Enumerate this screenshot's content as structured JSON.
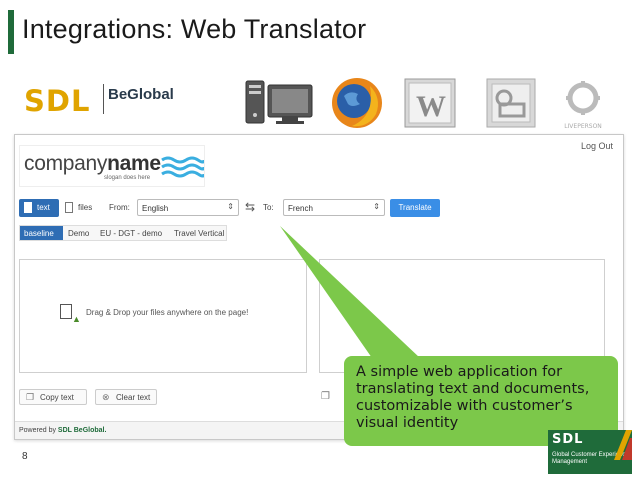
{
  "slide": {
    "title": "Integrations: Web Translator",
    "page_number": "8"
  },
  "logos": {
    "sdl": "SDL",
    "beglobal": "BeGlobal",
    "liveperson": "LIVEPERSON",
    "word_letter": "W"
  },
  "app": {
    "logout": "Log Out",
    "company_name_light": "company",
    "company_name_bold": "name",
    "slogan": "slogan does here",
    "tab_text": "text",
    "tab_files": "files",
    "from_label": "From:",
    "from_value": "English",
    "to_label": "To:",
    "to_value": "French",
    "translate_button": "Translate",
    "subtabs": [
      "baseline",
      "Demo",
      "EU - DGT - demo",
      "Travel Vertical"
    ],
    "drop_text": "Drag & Drop your files anywhere on the page!",
    "copy_text": "Copy text",
    "clear_text": "Clear text",
    "powered_prefix": "Powered by ",
    "powered_brand": "SDL BeGlobal."
  },
  "callout": {
    "text": "A simple web application for translating text and documents, customizable with customer’s visual identity",
    "color": "#7cc84a"
  },
  "corner_logo": {
    "title": "SDL",
    "subtitle": "Global Customer Experience Management"
  },
  "colors": {
    "title_accent": "#1f6b3a",
    "sdl_yellow": "#e0a400",
    "translate_button": "#3a8ee6",
    "active_tab": "#2e6db4"
  }
}
